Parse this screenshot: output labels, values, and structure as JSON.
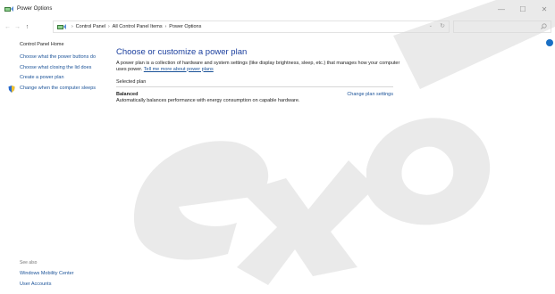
{
  "window": {
    "title": "Power Options",
    "minimize_label": "—",
    "maximize_label": "☐",
    "close_label": "✕"
  },
  "nav": {
    "back_glyph": "←",
    "forward_glyph": "→",
    "up_glyph": "↑",
    "breadcrumb": [
      "Control Panel",
      "All Control Panel Items",
      "Power Options"
    ],
    "separator": "›",
    "dropdown_glyph": "⌄",
    "refresh_glyph": "↻",
    "search_placeholder": ""
  },
  "sidebar": {
    "home": "Control Panel Home",
    "links": [
      "Choose what the power buttons do",
      "Choose what closing the lid does",
      "Create a power plan",
      "Change when the computer sleeps"
    ],
    "see_also_title": "See also",
    "see_also": [
      "Windows Mobility Center",
      "User Accounts"
    ]
  },
  "main": {
    "title": "Choose or customize a power plan",
    "description": "A power plan is a collection of hardware and system settings (like display brightness, sleep, etc.) that manages how your computer uses power.",
    "description_link": "Tell me more about power plans",
    "selected_plan_label": "Selected plan",
    "plan_name": "Balanced",
    "plan_description": "Automatically balances performance with energy consumption on capable hardware.",
    "plan_settings_link": "Change plan settings"
  },
  "icons": {
    "app": "power-options-icon",
    "shield": "uac-shield-icon",
    "search": "search-icon",
    "help": "help-icon"
  },
  "colors": {
    "link": "#1a5298",
    "heading": "#1a3e9e",
    "watermark": "#d9d9d9"
  }
}
